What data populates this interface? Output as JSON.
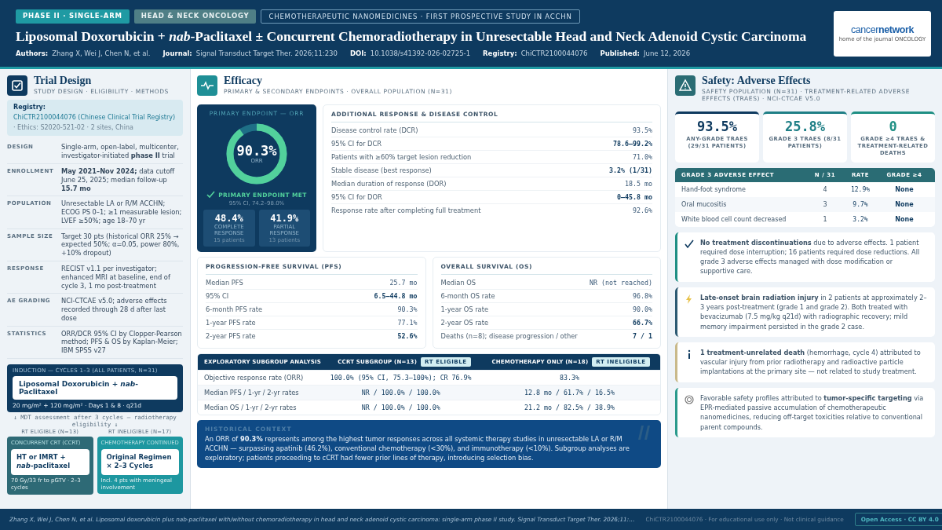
{
  "header": {
    "chips": [
      {
        "text": "PHASE II · SINGLE-ARM",
        "kind": "filled"
      },
      {
        "text": "HEAD & NECK ONCOLOGY",
        "kind": "muted"
      },
      {
        "text": "CHEMOTHERAPEUTIC NANOMEDICINES · FIRST PROSPECTIVE STUDY IN ACCHN",
        "kind": "outline"
      }
    ],
    "title": "Liposomal Doxorubicin + *nab*-Paclitaxel ± Concurrent Chemoradiotherapy in Unresectable Head and Neck Adenoid Cystic Carcinoma",
    "meta": [
      {
        "label": "Authors:",
        "value": "Zhang X, Wei J, Chen N, et al."
      },
      {
        "label": "Journal:",
        "value": "Signal Transduct Target Ther. 2026;11:230"
      },
      {
        "label": "DOI:",
        "value": "10.1038/s41392-026-02725-1"
      },
      {
        "label": "Registry:",
        "value": "ChiCTR2100044076"
      },
      {
        "label": "Published:",
        "value": "June 12, 2026"
      }
    ],
    "logo": {
      "part_a": "cancer",
      "part_b": "network",
      "tagline": "home of the journal ONCOLOGY"
    }
  },
  "design": {
    "title": "Trial Design",
    "subtitle": "STUDY DESIGN · ELIGIBILITY · METHODS",
    "registry": {
      "label": "Registry:",
      "value": "ChiCTR2100044076 (Chinese Clinical Trial Registry)",
      "note": "· Ethics: S2020-521-02 · 2 sites, China"
    },
    "rows": [
      {
        "label": "DESIGN",
        "text": "Single-arm, open-label, multicenter, investigator-initiated **phase II** trial"
      },
      {
        "label": "ENROLLMENT",
        "text": "**May 2021–Nov 2024;** data cutoff June 25, 2025; median follow-up **15.7 mo**"
      },
      {
        "label": "POPULATION",
        "text": "Unresectable LA or R/M ACCHN; ECOG PS 0–1; ≥1 measurable lesion; LVEF ≥50%; age 18–70 yr"
      },
      {
        "label": "SAMPLE SIZE",
        "text": "Target 30 pts (historical ORR 25% → expected 50%; α=0.05, power 80%, +10% dropout)"
      },
      {
        "label": "RESPONSE",
        "text": "RECIST v1.1 per investigator; enhanced MRI at baseline, end of cycle 3, 1 mo post-treatment"
      },
      {
        "label": "AE GRADING",
        "text": "NCI-CTCAE v5.0; adverse effects recorded through 28 d after last dose"
      },
      {
        "label": "STATISTICS",
        "text": "ORR/DCR 95% CI by Clopper-Pearson method; PFS & OS by Kaplan-Meier; IBM SPSS v27"
      }
    ],
    "flow": {
      "induction": {
        "heading": "INDUCTION — CYCLES 1–3 (ALL PATIENTS, N=31)",
        "regimen": "Liposomal Doxorubicin + *nab*-Paclitaxel",
        "dose": "20 mg/m² + 120 mg/m² · Days 1 & 8 · q21d"
      },
      "assessment": "↓  MDT assessment after 3 cycles — radiotherapy eligibility  ↓",
      "branches": [
        {
          "label": "RT ELIGIBLE (N=13)",
          "heading": "CONCURRENT CRT (CCRT)",
          "regimen": "HT or IMRT + *nab*-paclitaxel",
          "note": "70 Gy/33 fr to pGTV · 2–3 cycles",
          "color": "#2e6a76"
        },
        {
          "label": "RT INELIGIBLE (N=17)",
          "heading": "CHEMOTHERAPY CONTINUED",
          "regimen": "Original Regimen × 2–3 Cycles",
          "note": "Incl. 4 pts with meningeal involvement",
          "color": "#1d97a0"
        }
      ]
    }
  },
  "efficacy": {
    "title": "Efficacy",
    "subtitle": "PRIMARY & SECONDARY ENDPOINTS · OVERALL POPULATION (N=31)",
    "orr": {
      "heading": "PRIMARY ENDPOINT — ORR",
      "value": "90.3%",
      "caption": "ORR",
      "level": 0.903,
      "status": "PRIMARY ENDPOINT MET",
      "ci": "95% CI, 74.2–98.0%",
      "tiles": [
        {
          "value": "48.4%",
          "label": "COMPLETE RESPONSE",
          "count": "15 patients"
        },
        {
          "value": "41.9%",
          "label": "PARTIAL RESPONSE",
          "count": "13 patients"
        }
      ]
    },
    "additional": {
      "heading": "ADDITIONAL RESPONSE & DISEASE CONTROL",
      "rows": [
        {
          "label": "Disease control rate (DCR)",
          "value": "93.5%",
          "strong": false
        },
        {
          "label": "95% CI for DCR",
          "value": "78.6–99.2%",
          "strong": true
        },
        {
          "label": "Patients with ≥60% target lesion reduction",
          "value": "71.0%",
          "strong": false
        },
        {
          "label": "Stable disease (best response)",
          "value": "3.2% (1/31)",
          "strong": true
        },
        {
          "label": "Median duration of response (DOR)",
          "value": "18.5 mo",
          "strong": false
        },
        {
          "label": "95% CI for DOR",
          "value": "0–45.8 mo",
          "strong": true
        },
        {
          "label": "Response rate after completing full treatment",
          "value": "92.6%",
          "strong": false
        }
      ]
    },
    "survival": [
      {
        "heading": "PROGRESSION-FREE SURVIVAL (PFS)",
        "rows": [
          {
            "label": "Median PFS",
            "value": "25.7 mo",
            "strong": false
          },
          {
            "label": "95% CI",
            "value": "6.5–44.8 mo",
            "strong": true
          },
          {
            "label": "6-month PFS rate",
            "value": "90.3%",
            "strong": false
          },
          {
            "label": "1-year PFS rate",
            "value": "77.1%",
            "strong": false
          },
          {
            "label": "2-year PFS rate",
            "value": "52.6%",
            "strong": true
          }
        ]
      },
      {
        "heading": "OVERALL SURVIVAL (OS)",
        "rows": [
          {
            "label": "Median OS",
            "value": "NR (not reached)",
            "strong": false
          },
          {
            "label": "6-month OS rate",
            "value": "96.8%",
            "strong": false
          },
          {
            "label": "1-year OS rate",
            "value": "90.0%",
            "strong": false
          },
          {
            "label": "2-year OS rate",
            "value": "66.7%",
            "strong": true
          },
          {
            "label": "Deaths (n=8); disease progression / other",
            "value": "7 / 1",
            "strong": true
          }
        ]
      }
    ],
    "subgroup": {
      "columns": [
        {
          "title": "EXPLORATORY SUBGROUP ANALYSIS"
        },
        {
          "title": "CCRT SUBGROUP (N=13)",
          "tag": "RT ELIGIBLE"
        },
        {
          "title": "CHEMOTHERAPY ONLY (N=18)",
          "tag": "RT INELIGIBLE"
        }
      ],
      "rows": [
        [
          "Objective response rate (ORR)",
          "100.0% (95% CI, 75.3–100%); CR 76.9%",
          "83.3%"
        ],
        [
          "Median PFS / 1-yr / 2-yr rates",
          "NR / 100.0% / 100.0%",
          "12.8 mo / 61.7% / 16.5%"
        ],
        [
          "Median OS / 1-yr / 2-yr rates",
          "NR / 100.0% / 100.0%",
          "21.2 mo / 82.5% / 38.9%"
        ]
      ]
    },
    "context": {
      "heading": "HISTORICAL CONTEXT",
      "text": "An ORR of **90.3%** represents among the highest tumor responses across all systemic therapy studies in unresectable LA or R/M ACCHN — surpassing apatinib (46.2%), conventional chemotherapy (<30%), and immunotherapy (<10%). Subgroup analyses are exploratory; patients proceeding to cCRT had fewer prior lines of therapy, introducing selection bias."
    }
  },
  "safety": {
    "title": "Safety: Adverse Effects",
    "subtitle": "SAFETY POPULATION (N=31) · TREATMENT-RELATED ADVERSE EFFECTS (TRAES) · NCI-CTCAE V5.0",
    "stats": [
      {
        "value": "93.5%",
        "label": "ANY-GRADE TRAES (29/31 PATIENTS)",
        "color": "#0e3a5f"
      },
      {
        "value": "25.8%",
        "label": "GRADE 3 TRAES (8/31 PATIENTS)",
        "color": "#1f7f86"
      },
      {
        "value": "0",
        "label": "GRADE ≥4 TRAES & TREATMENT-RELATED DEATHS",
        "color": "#1f8f84"
      }
    ],
    "table": {
      "columns": [
        "GRADE 3 ADVERSE EFFECT",
        "N / 31",
        "RATE",
        "GRADE ≥4"
      ],
      "rows": [
        [
          "Hand-foot syndrome",
          "4",
          "12.9%",
          "None"
        ],
        [
          "Oral mucositis",
          "3",
          "9.7%",
          "None"
        ],
        [
          "White blood cell count decreased",
          "1",
          "3.2%",
          "None"
        ]
      ]
    },
    "notes": [
      {
        "kind": "check",
        "color": "#1f8f84",
        "text": "**No treatment discontinuations** due to adverse effects. 1 patient required dose interruption; 16 patients required dose reductions. All grade 3 adverse effects managed with dose modification or supportive care."
      },
      {
        "kind": "bolt",
        "color": "#2c5a73",
        "text": "**Late-onset brain radiation injury** in 2 patients at approximately 2–3 years post-treatment (grade 1 and grade 2). Both treated with bevacizumab (7.5 mg/kg q21d) with radiographic recovery; mild memory impairment persisted in the grade 2 case."
      },
      {
        "kind": "info",
        "color": "#c9b98a",
        "text": "**1 treatment-unrelated death** (hemorrhage, cycle 4) attributed to vascular injury from prior radiotherapy and radioactive particle implantations at the primary site — not related to study treatment."
      },
      {
        "kind": "target",
        "color": "#2a9a8c",
        "text": "Favorable safety profiles attributed to **tumor-specific targeting** via EPR-mediated passive accumulation of chemotherapeutic nanomedicines, reducing off-target toxicities relative to conventional parent compounds."
      }
    ]
  },
  "footer": {
    "citation": "Zhang X, Wei J, Chen N, et al. Liposomal doxorubicin plus nab-paclitaxel with/without chemoradiotherapy in head and neck adenoid cystic carcinoma: single-arm phase II study. Signal Transduct Target Ther. 2026;11:…",
    "note": "ChiCTR2100044076 · For educational use only · Not clinical guidance",
    "badge": "Open Access · CC BY 4.0"
  }
}
